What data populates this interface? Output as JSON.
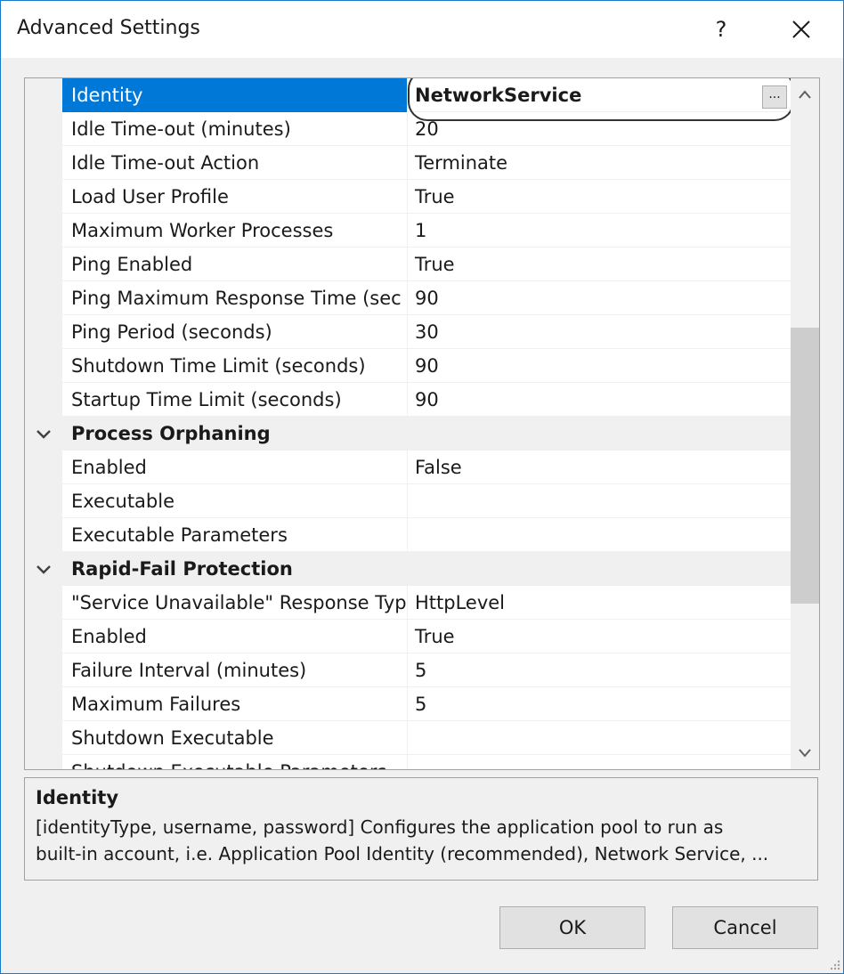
{
  "window": {
    "title": "Advanced Settings",
    "help_label": "?",
    "close_label": "✕"
  },
  "grid": {
    "ellipsis_label": "...",
    "rows": [
      {
        "name": "Identity",
        "value": "NetworkService",
        "selected": true
      },
      {
        "name": "Idle Time-out (minutes)",
        "value": "20"
      },
      {
        "name": "Idle Time-out Action",
        "value": "Terminate"
      },
      {
        "name": "Load User Profile",
        "value": "True"
      },
      {
        "name": "Maximum Worker Processes",
        "value": "1"
      },
      {
        "name": "Ping Enabled",
        "value": "True"
      },
      {
        "name": "Ping Maximum Response Time (sec",
        "value": "90"
      },
      {
        "name": "Ping Period (seconds)",
        "value": "30"
      },
      {
        "name": "Shutdown Time Limit (seconds)",
        "value": "90"
      },
      {
        "name": "Startup Time Limit (seconds)",
        "value": "90"
      },
      {
        "category": "Process Orphaning"
      },
      {
        "name": "Enabled",
        "value": "False"
      },
      {
        "name": "Executable",
        "value": ""
      },
      {
        "name": "Executable Parameters",
        "value": ""
      },
      {
        "category": "Rapid-Fail Protection"
      },
      {
        "name": "\"Service Unavailable\" Response Type",
        "value": "HttpLevel"
      },
      {
        "name": "Enabled",
        "value": "True"
      },
      {
        "name": "Failure Interval (minutes)",
        "value": "5"
      },
      {
        "name": "Maximum Failures",
        "value": "5"
      },
      {
        "name": "Shutdown Executable",
        "value": ""
      },
      {
        "name": "Shutdown Executable Parameters",
        "value": ""
      }
    ]
  },
  "description": {
    "title": "Identity",
    "text_line1": "[identityType, username, password] Configures the application pool to run as",
    "text_line2": "built-in account, i.e. Application Pool Identity (recommended), Network Service, ..."
  },
  "buttons": {
    "ok": "OK",
    "cancel": "Cancel"
  },
  "colors": {
    "accent": "#0078d7",
    "border": "#1979ca"
  }
}
